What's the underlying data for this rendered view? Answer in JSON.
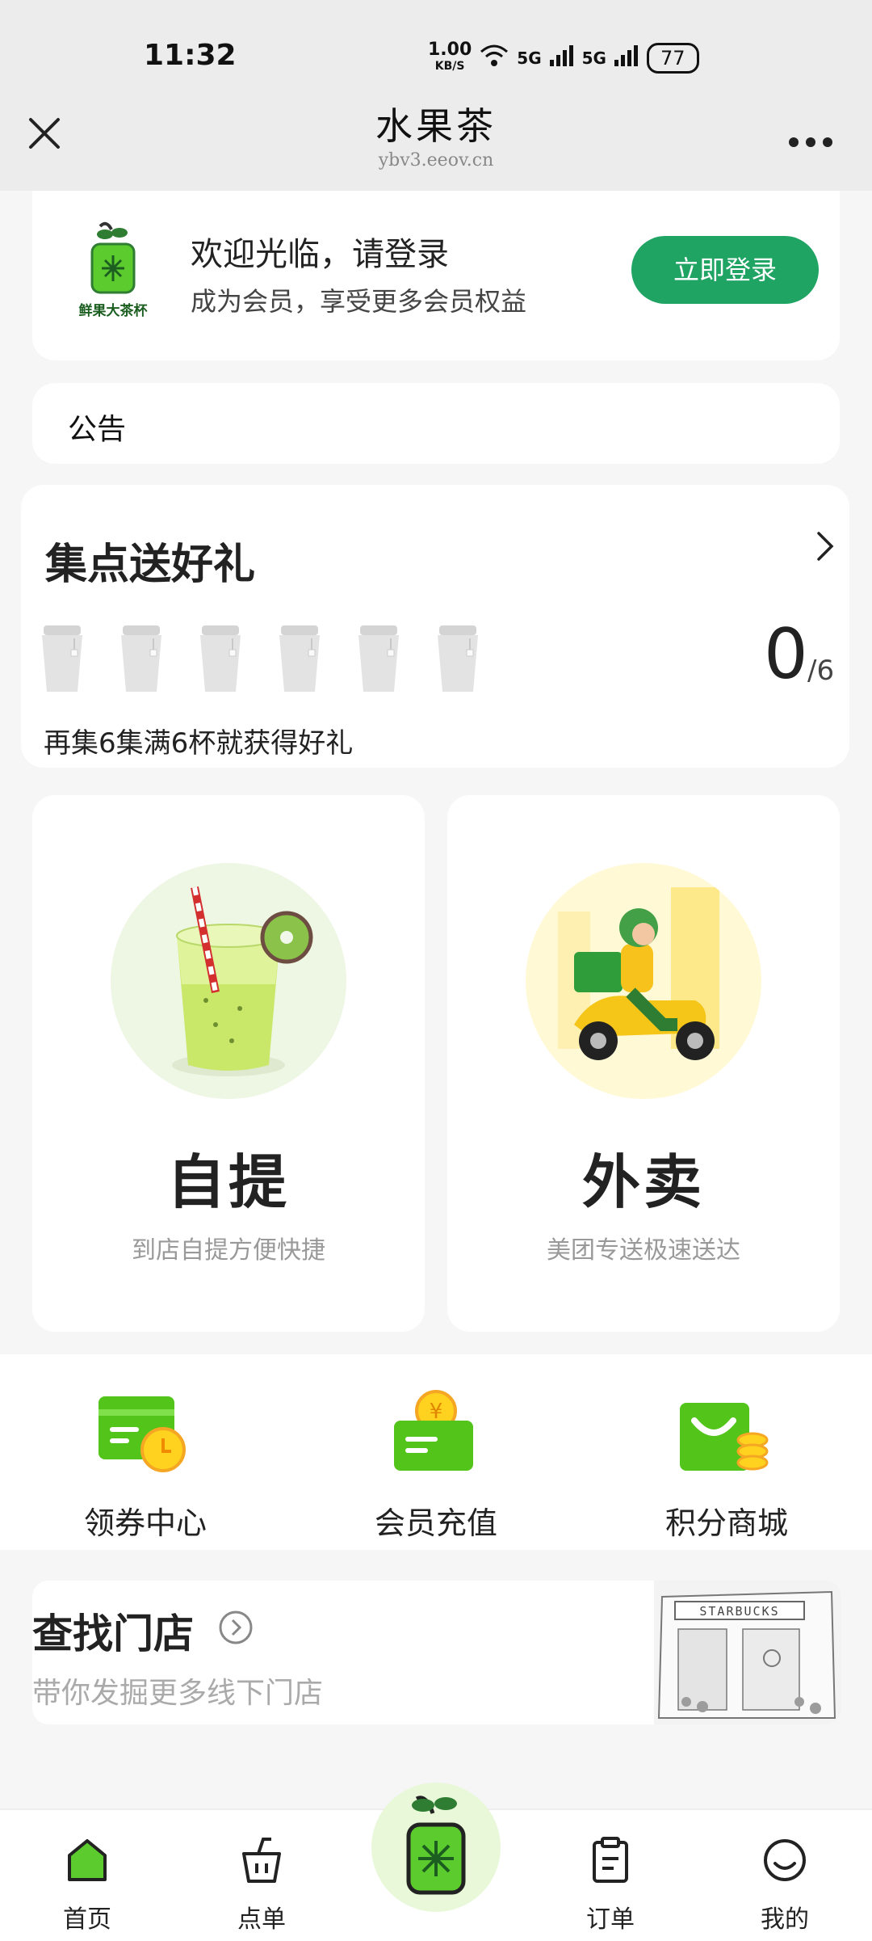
{
  "status": {
    "time": "11:32",
    "net_speed": "1.00",
    "net_unit": "KB/S",
    "signal_1": "5G",
    "signal_2": "5G",
    "battery": "77"
  },
  "nav": {
    "title": "水果茶",
    "subtitle": "ybv3.eeov.cn"
  },
  "login": {
    "logo_text": "鲜果大茶杯",
    "title": "欢迎光临，请登录",
    "subtitle": "成为会员，享受更多会员权益",
    "button": "立即登录"
  },
  "notice": {
    "label": "公告"
  },
  "points": {
    "title": "集点送好礼",
    "count": "0",
    "total": "/6",
    "hint": "再集6集满6杯就获得好礼",
    "cups_total": 6,
    "cups_filled": 0
  },
  "order": {
    "pickup": {
      "title": "自提",
      "subtitle": "到店自提方便快捷"
    },
    "delivery": {
      "title": "外卖",
      "subtitle": "美团专送极速送达"
    }
  },
  "quick": [
    {
      "label": "领券中心",
      "icon": "coupon-icon"
    },
    {
      "label": "会员充值",
      "icon": "recharge-icon"
    },
    {
      "label": "积分商城",
      "icon": "shopping-bag-icon"
    }
  ],
  "store": {
    "title": "查找门店",
    "subtitle": "带你发掘更多线下门店",
    "sign_text": "STARBUCKS"
  },
  "tabs": [
    {
      "label": "首页",
      "icon": "home-icon",
      "active": true
    },
    {
      "label": "点单",
      "icon": "cup-icon"
    },
    {
      "label": "订单",
      "icon": "clipboard-icon"
    },
    {
      "label": "我的",
      "icon": "smiley-icon"
    }
  ],
  "colors": {
    "accent": "#1fa463",
    "brand_green": "#4cc43a",
    "coin_yellow": "#ffd21f"
  }
}
